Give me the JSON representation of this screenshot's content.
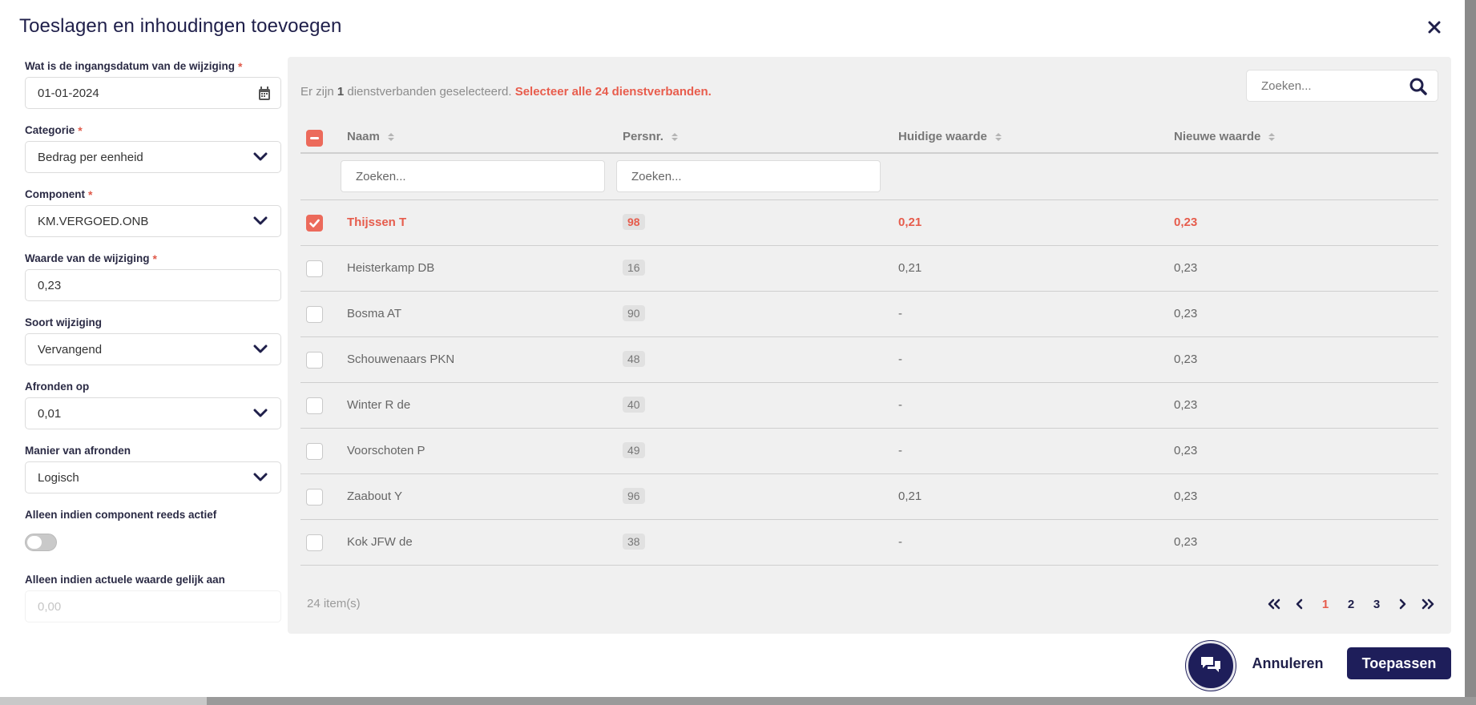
{
  "modal": {
    "title": "Toeslagen en inhoudingen toevoegen"
  },
  "form": {
    "effective_date": {
      "label": "Wat is de ingangsdatum van de wijziging",
      "value": "01-01-2024",
      "required": true,
      "icon": "calendar-icon"
    },
    "category": {
      "label": "Categorie",
      "value": "Bedrag per eenheid",
      "required": true
    },
    "component": {
      "label": "Component",
      "value": "KM.VERGOED.ONB",
      "required": true
    },
    "change_value": {
      "label": "Waarde van de wijziging",
      "value": "0,23",
      "required": true
    },
    "change_type": {
      "label": "Soort wijziging",
      "value": "Vervangend"
    },
    "round_to": {
      "label": "Afronden op",
      "value": "0,01"
    },
    "rounding_method": {
      "label": "Manier van afronden",
      "value": "Logisch"
    },
    "only_if_active": {
      "label": "Alleen indien component reeds actief",
      "enabled": false
    },
    "only_if_equal": {
      "label": "Alleen indien actuele waarde gelijk aan",
      "placeholder": "0,00"
    },
    "required_mark": "*"
  },
  "selection": {
    "prefix": "Er zijn",
    "count": "1",
    "suffix": "dienstverbanden geselecteerd.",
    "select_all": "Selecteer alle 24 dienstverbanden."
  },
  "search": {
    "placeholder": "Zoeken..."
  },
  "table": {
    "columns": [
      "Naam",
      "Persnr.",
      "Huidige waarde",
      "Nieuwe waarde"
    ],
    "filter_placeholder": "Zoeken...",
    "rows": [
      {
        "name": "Thijssen T",
        "persnr": "98",
        "current": "0,21",
        "new": "0,23",
        "selected": true
      },
      {
        "name": "Heisterkamp DB",
        "persnr": "16",
        "current": "0,21",
        "new": "0,23",
        "selected": false
      },
      {
        "name": "Bosma AT",
        "persnr": "90",
        "current": "-",
        "new": "0,23",
        "selected": false
      },
      {
        "name": "Schouwenaars PKN",
        "persnr": "48",
        "current": "-",
        "new": "0,23",
        "selected": false
      },
      {
        "name": "Winter R de",
        "persnr": "40",
        "current": "-",
        "new": "0,23",
        "selected": false
      },
      {
        "name": "Voorschoten P",
        "persnr": "49",
        "current": "-",
        "new": "0,23",
        "selected": false
      },
      {
        "name": "Zaabout Y",
        "persnr": "96",
        "current": "0,21",
        "new": "0,23",
        "selected": false
      },
      {
        "name": "Kok JFW de",
        "persnr": "38",
        "current": "-",
        "new": "0,23",
        "selected": false
      }
    ],
    "total_items": "24 item(s)"
  },
  "pagination": {
    "pages": [
      "1",
      "2",
      "3"
    ],
    "current": "1"
  },
  "actions": {
    "cancel": "Annuleren",
    "apply": "Toepassen"
  },
  "colors": {
    "accent": "#e85d4d",
    "navy": "#1e1e5a"
  }
}
